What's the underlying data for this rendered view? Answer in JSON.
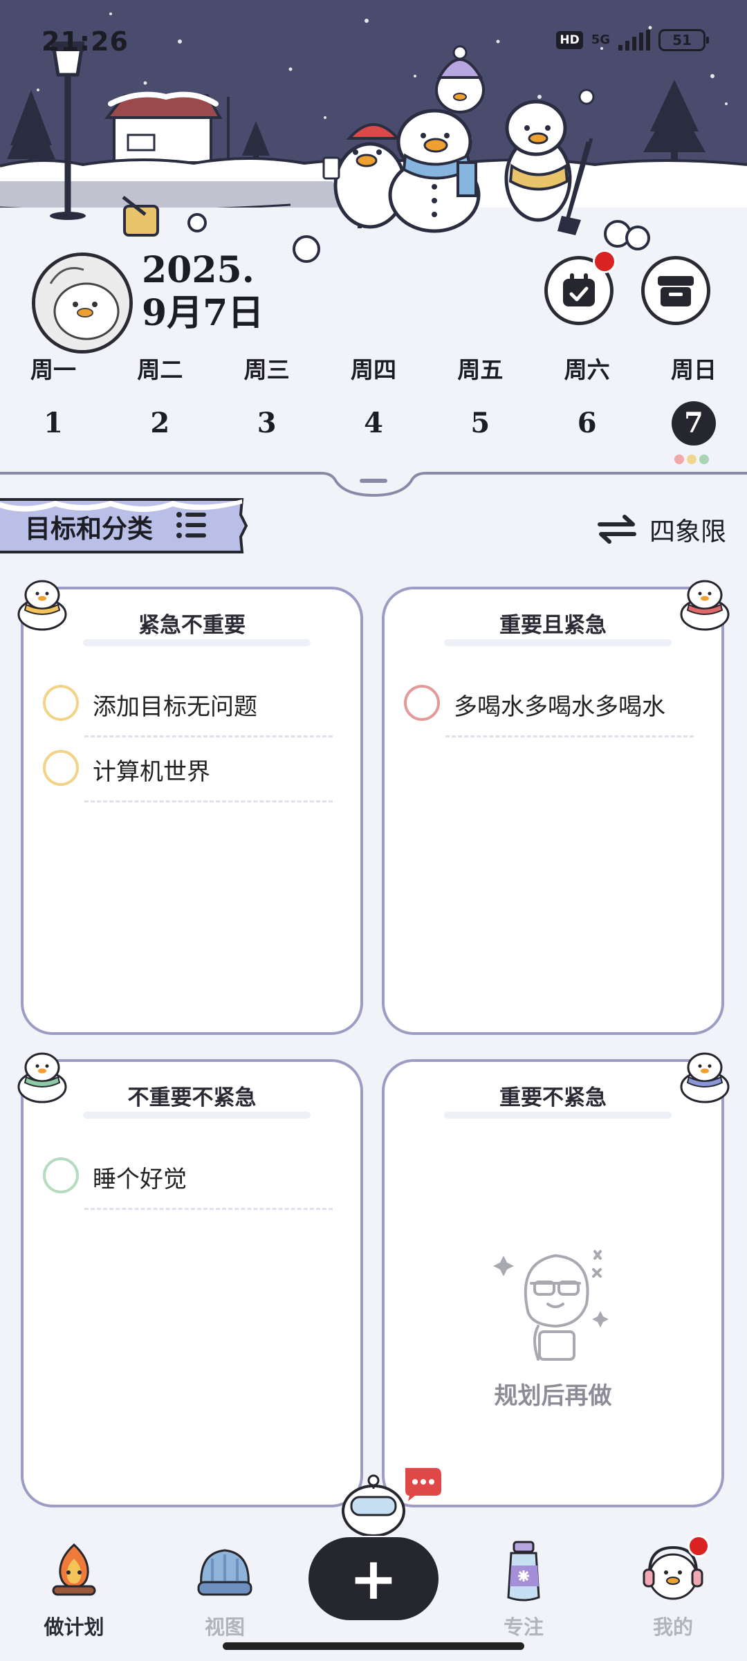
{
  "status_bar": {
    "time": "21:26",
    "hd": "HD",
    "network": "5G",
    "battery": "51"
  },
  "header": {
    "date_line1": "2025.",
    "date_line2": "9月7日",
    "calendar_button": "calendar-check-icon",
    "archive_button": "archive-box-icon"
  },
  "week": {
    "days": [
      {
        "name": "周一",
        "num": "1"
      },
      {
        "name": "周二",
        "num": "2"
      },
      {
        "name": "周三",
        "num": "3"
      },
      {
        "name": "周四",
        "num": "4"
      },
      {
        "name": "周五",
        "num": "5"
      },
      {
        "name": "周六",
        "num": "6"
      },
      {
        "name": "周日",
        "num": "7"
      }
    ],
    "selected_day": "7",
    "mood_colors": [
      "#f0a8a8",
      "#f0d890",
      "#a8d4b4"
    ]
  },
  "section": {
    "goals_label": "目标和分类",
    "view_label": "四象限"
  },
  "quadrants": [
    {
      "title": "紧急不重要",
      "accent": "#f2d488",
      "tasks": [
        "添加目标无问题",
        "计算机世界"
      ]
    },
    {
      "title": "重要且紧急",
      "accent": "#e29a9a",
      "tasks": [
        "多喝水多喝水多喝水"
      ]
    },
    {
      "title": "不重要不紧急",
      "accent": "#b4dcc0",
      "tasks": [
        "睡个好觉"
      ]
    },
    {
      "title": "重要不紧急",
      "accent": "#9aa4d8",
      "tasks": [],
      "empty_text": "规划后再做"
    }
  ],
  "tabbar": {
    "tabs": [
      {
        "label": "做计划",
        "active": true
      },
      {
        "label": "视图",
        "active": false
      },
      {
        "label": "专注",
        "active": false
      },
      {
        "label": "我的",
        "active": false
      }
    ],
    "add_button": "+"
  }
}
